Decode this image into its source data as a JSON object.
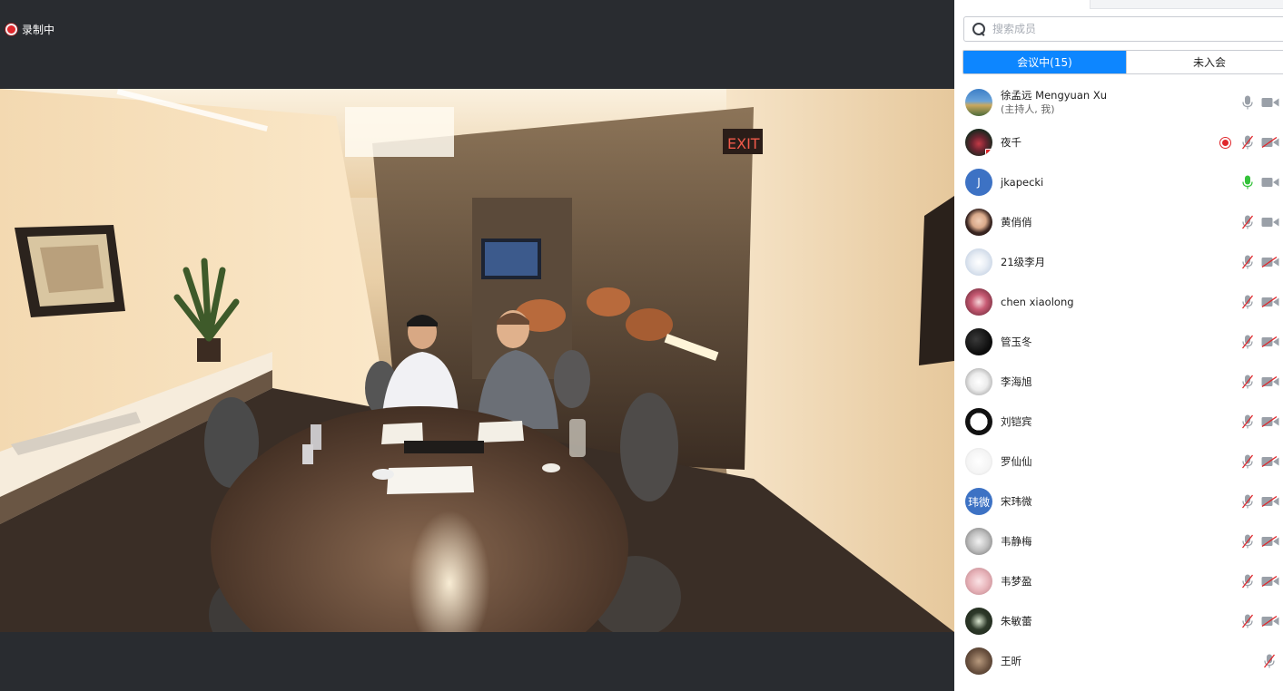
{
  "recording": {
    "label": "录制中"
  },
  "search": {
    "placeholder": "搜索成员"
  },
  "tabs": [
    {
      "label": "会议中(15)",
      "active": true
    },
    {
      "label": "未入会",
      "active": false
    }
  ],
  "colors": {
    "accent": "#0d86ff",
    "recording": "#e0262b",
    "mic_active": "#34c23a",
    "icon_gray": "#9aa0a8"
  },
  "participants": [
    {
      "name": "徐孟远 Mengyuan Xu",
      "sub": "(主持人, 我)",
      "avatar": "photo-landscape",
      "mic": "on",
      "cam": "on"
    },
    {
      "name": "夜千",
      "avatar": "photo-flower",
      "recording": true,
      "mic": "muted",
      "cam": "off"
    },
    {
      "name": "jkapecki",
      "avatar_text": "J",
      "avatar": "letter-blue",
      "mic": "speaking",
      "cam": "on"
    },
    {
      "name": "黄俏俏",
      "avatar": "photo-portrait",
      "mic": "muted",
      "cam": "on"
    },
    {
      "name": "21级李月",
      "avatar": "photo-cartoon",
      "mic": "muted",
      "cam": "off"
    },
    {
      "name": "chen xiaolong",
      "avatar": "photo-anime",
      "mic": "muted",
      "cam": "off"
    },
    {
      "name": "管玉冬",
      "avatar": "photo-dark",
      "mic": "muted",
      "cam": "off"
    },
    {
      "name": "李海旭",
      "avatar": "photo-sketch",
      "mic": "muted",
      "cam": "off"
    },
    {
      "name": "刘铠宾",
      "avatar": "photo-panda",
      "mic": "muted",
      "cam": "off"
    },
    {
      "name": "罗仙仙",
      "avatar": "photo-bird",
      "mic": "muted",
      "cam": "off"
    },
    {
      "name": "宋玮微",
      "avatar_text": "玮微",
      "avatar": "letter-blue",
      "mic": "muted",
      "cam": "off"
    },
    {
      "name": "韦静梅",
      "avatar": "photo-cat",
      "mic": "muted",
      "cam": "off"
    },
    {
      "name": "韦梦盈",
      "avatar": "photo-pink",
      "mic": "muted",
      "cam": "off"
    },
    {
      "name": "朱敏蕾",
      "avatar": "photo-green",
      "mic": "muted",
      "cam": "off"
    },
    {
      "name": "王昕",
      "avatar": "photo-brown",
      "mic": "muted",
      "cam": "none"
    }
  ]
}
